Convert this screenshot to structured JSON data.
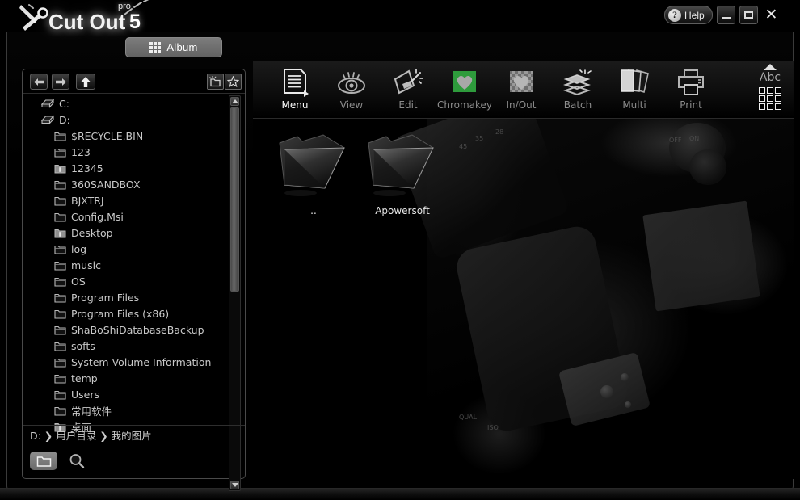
{
  "app": {
    "brand": "Cut Out",
    "brand_sup": "pro",
    "brand_version": "5",
    "album_button": "Album",
    "help_button": "Help",
    "help_symbol": "?",
    "minimize_symbol": "",
    "maximize_symbol": "",
    "close_symbol": "✕"
  },
  "file_panel": {
    "nav": {
      "back": "←",
      "forward": "→",
      "up": "⬆"
    },
    "new_folder_icon": "new-folder-icon",
    "favorite_icon": "star-icon",
    "tree": [
      {
        "label": "C:",
        "icon": "drive-icon",
        "level": 0
      },
      {
        "label": "D:",
        "icon": "drive-icon",
        "level": 0
      },
      {
        "label": "$RECYCLE.BIN",
        "icon": "folder-icon",
        "level": 1
      },
      {
        "label": "123",
        "icon": "folder-icon",
        "level": 1
      },
      {
        "label": "12345",
        "icon": "folder-special-icon",
        "level": 1
      },
      {
        "label": "360SANDBOX",
        "icon": "folder-icon",
        "level": 1
      },
      {
        "label": "BJXTRJ",
        "icon": "folder-icon",
        "level": 1
      },
      {
        "label": "Config.Msi",
        "icon": "folder-icon",
        "level": 1
      },
      {
        "label": "Desktop",
        "icon": "folder-special-icon",
        "level": 1
      },
      {
        "label": "log",
        "icon": "folder-icon",
        "level": 1
      },
      {
        "label": "music",
        "icon": "folder-icon",
        "level": 1
      },
      {
        "label": "OS",
        "icon": "folder-icon",
        "level": 1
      },
      {
        "label": "Program Files",
        "icon": "folder-icon",
        "level": 1
      },
      {
        "label": "Program Files (x86)",
        "icon": "folder-icon",
        "level": 1
      },
      {
        "label": "ShaBoShiDatabaseBackup",
        "icon": "folder-icon",
        "level": 1
      },
      {
        "label": "softs",
        "icon": "folder-icon",
        "level": 1
      },
      {
        "label": "System Volume Information",
        "icon": "folder-icon",
        "level": 1
      },
      {
        "label": "temp",
        "icon": "folder-icon",
        "level": 1
      },
      {
        "label": "Users",
        "icon": "folder-icon",
        "level": 1
      },
      {
        "label": "常用软件",
        "icon": "folder-icon",
        "level": 1
      },
      {
        "label": "桌面",
        "icon": "folder-special-icon",
        "level": 1
      }
    ],
    "path": "D: ❯ 用户目录 ❯ 我的图片",
    "bottom_buttons": [
      {
        "name": "browse-folder-button",
        "icon": "folder-icon",
        "active": true
      },
      {
        "name": "search-button",
        "icon": "search-icon",
        "active": false
      }
    ],
    "scrollbar": {
      "up": "▲",
      "down": "▼"
    }
  },
  "toolbar": {
    "items": [
      {
        "label": "Menu",
        "icon": "menu-document-icon",
        "active": true
      },
      {
        "label": "View",
        "icon": "eye-icon",
        "active": false
      },
      {
        "label": "Edit",
        "icon": "magic-wand-edit-icon",
        "active": false
      },
      {
        "label": "Chromakey",
        "icon": "green-heart-icon",
        "active": false
      },
      {
        "label": "In/Out",
        "icon": "transparent-heart-icon",
        "active": false
      },
      {
        "label": "Batch",
        "icon": "batch-layers-icon",
        "active": false
      },
      {
        "label": "Multi",
        "icon": "multi-pages-icon",
        "active": false
      },
      {
        "label": "Print",
        "icon": "printer-icon",
        "active": false
      }
    ],
    "right": {
      "collapse_icon": "triangle-up-icon",
      "label": "Abc",
      "grid_icon": "grid-3x3-icon"
    }
  },
  "content": {
    "items": [
      {
        "name": "..",
        "icon": "folder-icon"
      },
      {
        "name": "Apowersoft",
        "icon": "folder-icon"
      }
    ],
    "background": "dark-dslr-camera-photo"
  },
  "colors": {
    "accent_green": "#2e9b3c",
    "panel_border": "#4a4a4a",
    "text_primary": "#e6e6e6",
    "text_muted": "#8d8d8d",
    "background": "#000000"
  }
}
